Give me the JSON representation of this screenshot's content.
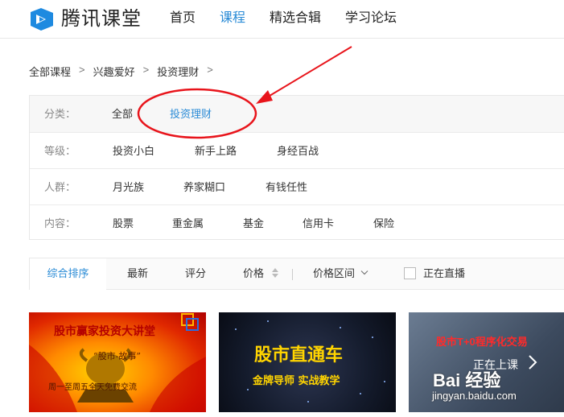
{
  "header": {
    "logo_text": "腾讯课堂",
    "nav": [
      "首页",
      "课程",
      "精选合辑",
      "学习论坛"
    ],
    "active_nav": "课程"
  },
  "breadcrumb": {
    "items": [
      "全部课程",
      "兴趣爱好",
      "投资理财"
    ],
    "separator": ">"
  },
  "filters": {
    "category": {
      "label": "分类：",
      "options": [
        "全部",
        "投资理财"
      ],
      "selected": "投资理财"
    },
    "level": {
      "label": "等级：",
      "options": [
        "投资小白",
        "新手上路",
        "身经百战"
      ]
    },
    "audience": {
      "label": "人群：",
      "options": [
        "月光族",
        "养家糊口",
        "有钱任性"
      ]
    },
    "content": {
      "label": "内容：",
      "options": [
        "股票",
        "重金属",
        "基金",
        "信用卡",
        "保险"
      ]
    }
  },
  "sortbar": {
    "options": [
      "综合排序",
      "最新",
      "评分",
      "价格",
      "价格区间"
    ],
    "active": "综合排序",
    "live_checkbox_label": "正在直播",
    "live_checked": false
  },
  "courses": [
    {
      "title": "股市赢家投资大讲堂",
      "subtitle": "“股市-故事”",
      "footer": "周一至周五全天免费交流"
    },
    {
      "title": "股市直通车",
      "subtitle": "金牌导师  实战教学"
    },
    {
      "title": "股市T+0程序化交易",
      "badge": "正在上课"
    }
  ],
  "watermark": {
    "brand": "Bai 经验",
    "url": "jingyan.baidu.com"
  },
  "colors": {
    "accent": "#2a8bd6",
    "annotation": "#e8141b"
  }
}
